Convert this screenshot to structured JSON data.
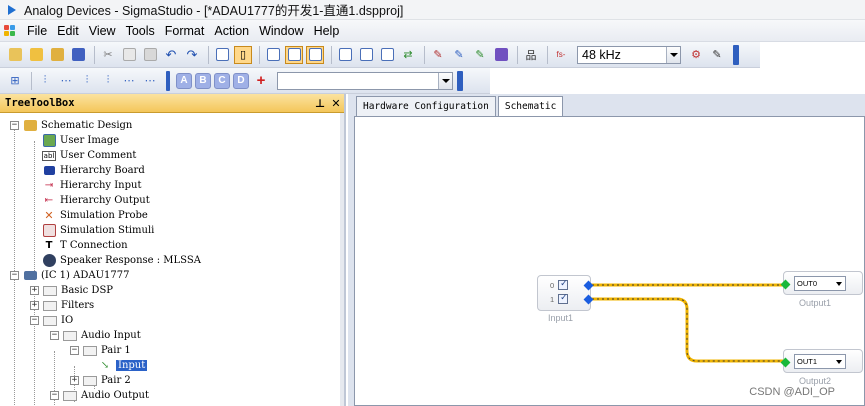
{
  "window": {
    "title": "Analog Devices - SigmaStudio - [*ADAU1777的开发1-直通1.dspproj]"
  },
  "menu": {
    "items": [
      "File",
      "Edit",
      "View",
      "Tools",
      "Format",
      "Action",
      "Window",
      "Help"
    ]
  },
  "toolbar": {
    "sample_rate": "48 kHz",
    "sample_rate_prefix": "fs-",
    "letter_buttons": [
      "A",
      "B",
      "C",
      "D"
    ],
    "add_label": "+"
  },
  "panel": {
    "title": "TreeToolBox",
    "pin": "⊥",
    "close": "✕"
  },
  "tree": {
    "schematic_design": "Schematic Design",
    "user_image": "User Image",
    "user_comment": "User Comment",
    "hierarchy_board": "Hierarchy Board",
    "hierarchy_input": "Hierarchy Input",
    "hierarchy_output": "Hierarchy Output",
    "simulation_probe": "Simulation Probe",
    "simulation_stimuli": "Simulation Stimuli",
    "t_connection": "T Connection",
    "speaker_response": "Speaker Response : MLSSA",
    "ic1": "(IC 1) ADAU1777",
    "basic_dsp": "Basic DSP",
    "filters": "Filters",
    "io": "IO",
    "audio_input": "Audio Input",
    "pair1": "Pair 1",
    "input": "Input",
    "pair2": "Pair 2",
    "audio_output": "Audio Output"
  },
  "tabs": {
    "hardware": "Hardware Configuration",
    "schematic": "Schematic"
  },
  "schematic": {
    "input_block": {
      "label": "Input1",
      "channels": [
        "0",
        "1"
      ]
    },
    "out0": {
      "value": "OUT0",
      "label": "Output1"
    },
    "out1": {
      "value": "OUT1",
      "label": "Output2"
    },
    "wire_color": "#f0b400"
  },
  "watermark": "CSDN @ADI_OP"
}
